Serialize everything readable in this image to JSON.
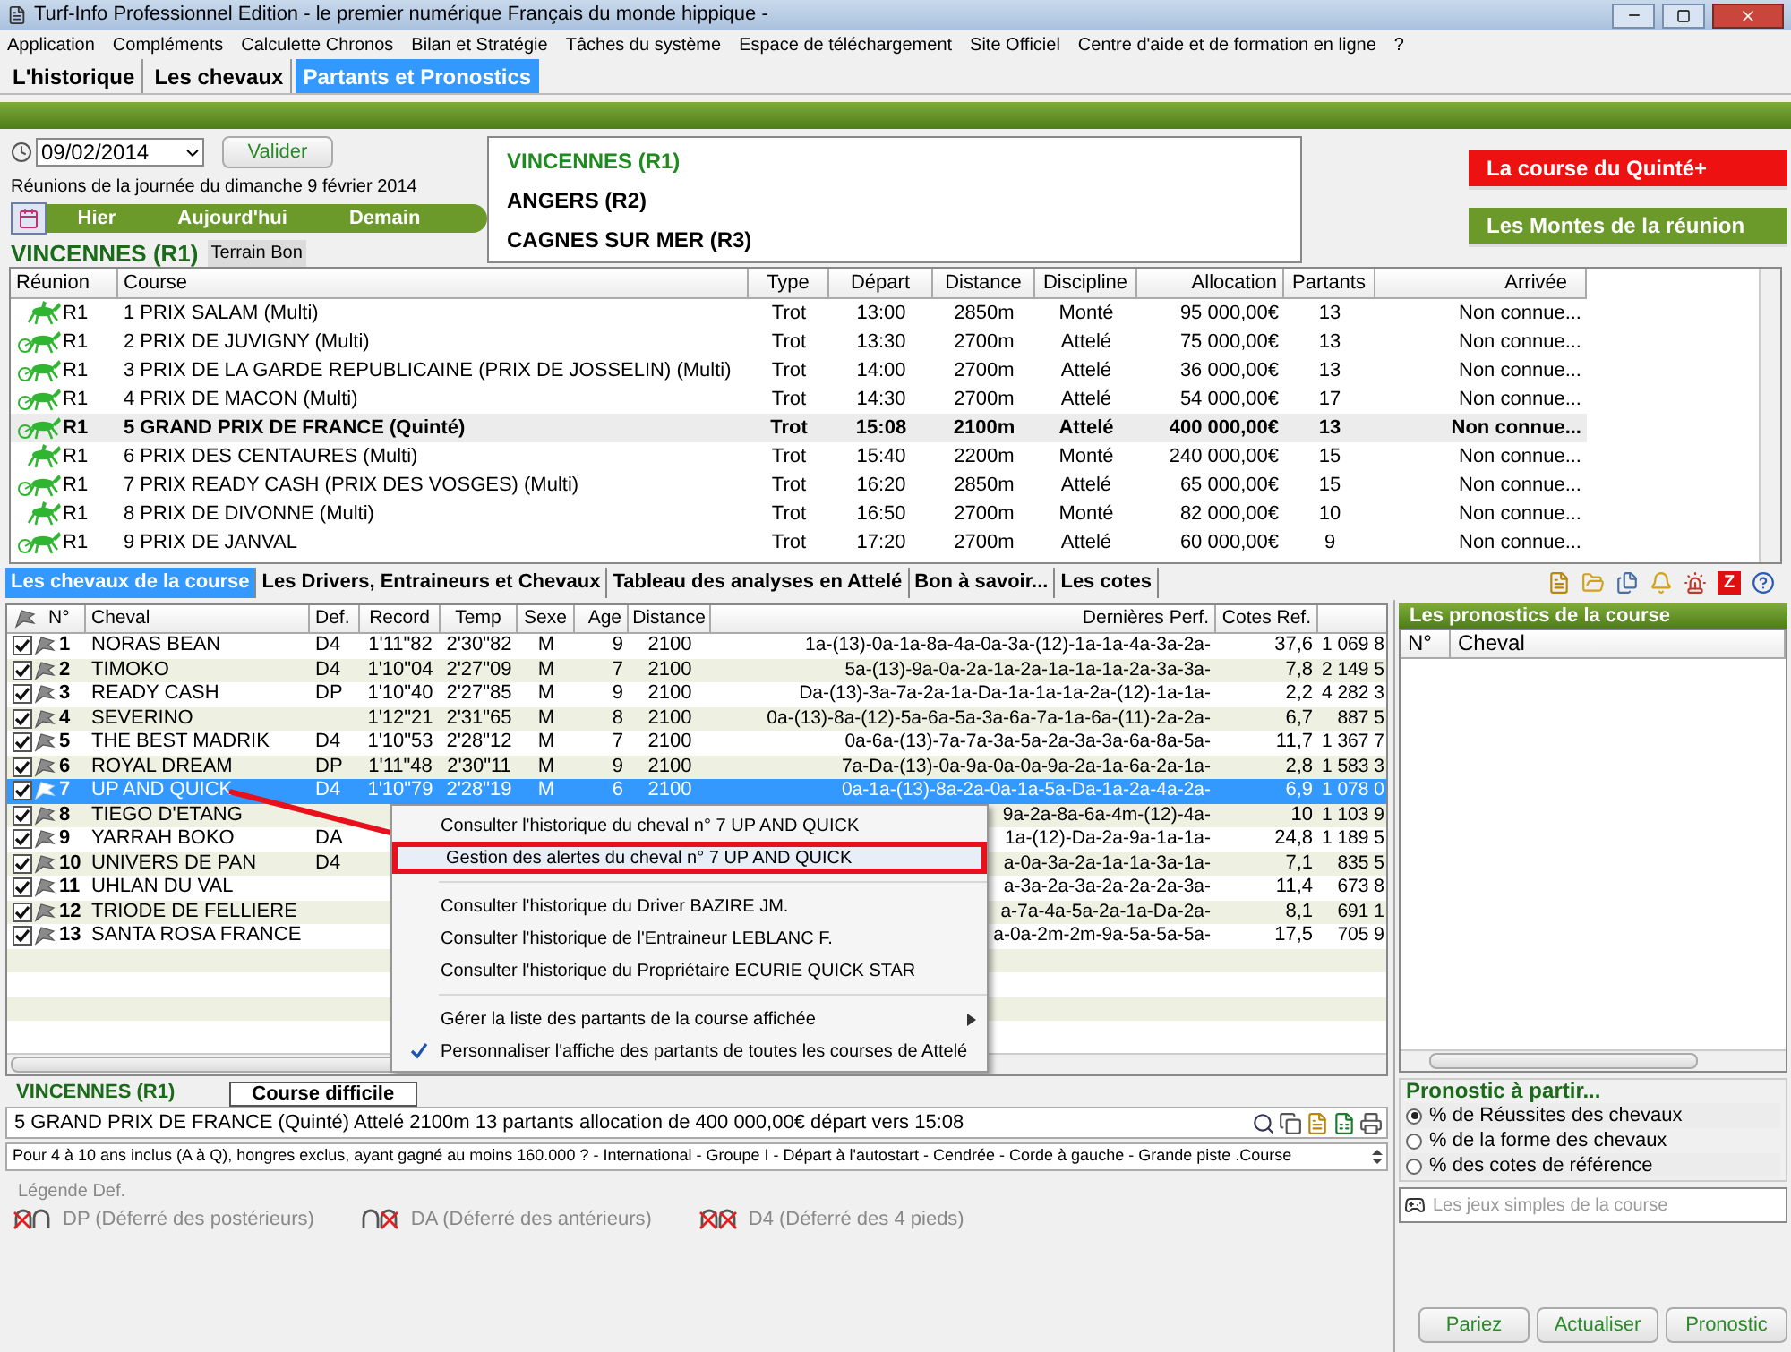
{
  "window": {
    "title": "Turf-Info Professionnel Edition - le premier numérique Français du monde hippique -"
  },
  "menu": [
    "Application",
    "Compléments",
    "Calculette Chronos",
    "Bilan et Stratégie",
    "Tâches du système",
    "Espace de téléchargement",
    "Site Officiel",
    "Centre d'aide et de formation en ligne",
    "?"
  ],
  "main_tabs": [
    {
      "label": "L'historique",
      "selected": false
    },
    {
      "label": "Les chevaux",
      "selected": false
    },
    {
      "label": "Partants et Pronostics",
      "selected": true
    }
  ],
  "date_field": {
    "value": "09/02/2014"
  },
  "validate_button": "Valider",
  "day_caption": "Réunions de la journée du dimanche 9 février 2014",
  "day_nav": [
    "Hier",
    "Aujourd'hui",
    "Demain"
  ],
  "current_meeting": {
    "name": "VINCENNES (R1)",
    "terrain": "Terrain Bon"
  },
  "meetings": [
    {
      "label": "VINCENNES (R1)",
      "selected": true
    },
    {
      "label": "ANGERS (R2)",
      "selected": false
    },
    {
      "label": "CAGNES SUR MER (R3)",
      "selected": false
    }
  ],
  "quick_buttons": [
    {
      "label": "La course du Quinté+",
      "color": "#ee1111"
    },
    {
      "label": "Les Montes de la réunion",
      "color": "#6b9a2b"
    }
  ],
  "races": {
    "columns": [
      "Réunion",
      "Course",
      "Type",
      "Départ",
      "Distance",
      "Discipline",
      "Allocation",
      "Partants",
      "Arrivée"
    ],
    "rows": [
      {
        "kind": "mounted",
        "reunion": "R1",
        "course": "1 PRIX SALAM (Multi)",
        "type": "Trot",
        "depart": "13:00",
        "distance": "2850m",
        "discipline": "Monté",
        "allocation": "95 000,00€",
        "partants": "13",
        "arrivee": "Non connue...",
        "selected": false
      },
      {
        "kind": "harness",
        "reunion": "R1",
        "course": "2 PRIX DE JUVIGNY (Multi)",
        "type": "Trot",
        "depart": "13:30",
        "distance": "2700m",
        "discipline": "Attelé",
        "allocation": "75 000,00€",
        "partants": "13",
        "arrivee": "Non connue...",
        "selected": false
      },
      {
        "kind": "harness",
        "reunion": "R1",
        "course": "3 PRIX DE LA GARDE REPUBLICAINE (PRIX DE JOSSELIN) (Multi)",
        "type": "Trot",
        "depart": "14:00",
        "distance": "2700m",
        "discipline": "Attelé",
        "allocation": "36 000,00€",
        "partants": "13",
        "arrivee": "Non connue...",
        "selected": false
      },
      {
        "kind": "harness",
        "reunion": "R1",
        "course": "4 PRIX DE MACON (Multi)",
        "type": "Trot",
        "depart": "14:30",
        "distance": "2700m",
        "discipline": "Attelé",
        "allocation": "54 000,00€",
        "partants": "17",
        "arrivee": "Non connue...",
        "selected": false
      },
      {
        "kind": "harness",
        "reunion": "R1",
        "course": "5 GRAND PRIX DE FRANCE (Quinté)",
        "type": "Trot",
        "depart": "15:08",
        "distance": "2100m",
        "discipline": "Attelé",
        "allocation": "400 000,00€",
        "partants": "13",
        "arrivee": "Non connue...",
        "selected": true
      },
      {
        "kind": "mounted",
        "reunion": "R1",
        "course": "6 PRIX DES CENTAURES (Multi)",
        "type": "Trot",
        "depart": "15:40",
        "distance": "2200m",
        "discipline": "Monté",
        "allocation": "240 000,00€",
        "partants": "15",
        "arrivee": "Non connue...",
        "selected": false
      },
      {
        "kind": "harness",
        "reunion": "R1",
        "course": "7 PRIX READY CASH (PRIX DES VOSGES) (Multi)",
        "type": "Trot",
        "depart": "16:20",
        "distance": "2850m",
        "discipline": "Attelé",
        "allocation": "65 000,00€",
        "partants": "15",
        "arrivee": "Non connue...",
        "selected": false
      },
      {
        "kind": "mounted",
        "reunion": "R1",
        "course": "8 PRIX DE DIVONNE (Multi)",
        "type": "Trot",
        "depart": "16:50",
        "distance": "2700m",
        "discipline": "Monté",
        "allocation": "82 000,00€",
        "partants": "10",
        "arrivee": "Non connue...",
        "selected": false
      },
      {
        "kind": "harness",
        "reunion": "R1",
        "course": "9 PRIX DE JANVAL",
        "type": "Trot",
        "depart": "17:20",
        "distance": "2700m",
        "discipline": "Attelé",
        "allocation": "60 000,00€",
        "partants": "9",
        "arrivee": "Non connue...",
        "selected": false
      }
    ]
  },
  "detail_tabs": [
    {
      "label": "Les chevaux de la course",
      "selected": true
    },
    {
      "label": "Les Drivers, Entraineurs et Chevaux",
      "selected": false
    },
    {
      "label": "Tableau des analyses en Attelé",
      "selected": false
    },
    {
      "label": "Bon à savoir...",
      "selected": false
    },
    {
      "label": "Les cotes",
      "selected": false
    }
  ],
  "toolbar_badge": "Z",
  "horses": {
    "columns": [
      "N°",
      "Cheval",
      "Def.",
      "Record",
      "Temp",
      "Sexe",
      "Age",
      "Distance",
      "Dernières Perf.",
      "Cotes Ref."
    ],
    "rows": [
      {
        "checked": true,
        "selected": false,
        "number": "1",
        "name": "NORAS BEAN",
        "def": "D4",
        "record": "1'11\"82",
        "temp": "2'30\"82",
        "sexe": "M",
        "age": "9",
        "distance": "2100",
        "perf": "1a-(13)-0a-1a-8a-4a-0a-3a-(12)-1a-1a-4a-3a-2a-",
        "cote": "37,6",
        "gains": "1 069 8"
      },
      {
        "checked": true,
        "selected": false,
        "number": "2",
        "name": "TIMOKO",
        "def": "D4",
        "record": "1'10\"04",
        "temp": "2'27\"09",
        "sexe": "M",
        "age": "7",
        "distance": "2100",
        "perf": "5a-(13)-9a-0a-2a-1a-2a-1a-1a-1a-2a-3a-3a-",
        "cote": "7,8",
        "gains": "2 149 5"
      },
      {
        "checked": true,
        "selected": false,
        "number": "3",
        "name": "READY CASH",
        "def": "DP",
        "record": "1'10\"40",
        "temp": "2'27\"85",
        "sexe": "M",
        "age": "9",
        "distance": "2100",
        "perf": "Da-(13)-3a-7a-2a-1a-Da-1a-1a-1a-2a-(12)-1a-1a-",
        "cote": "2,2",
        "gains": "4 282 3"
      },
      {
        "checked": true,
        "selected": false,
        "number": "4",
        "name": "SEVERINO",
        "record": "1'12\"21",
        "temp": "2'31\"65",
        "sexe": "M",
        "age": "8",
        "distance": "2100",
        "perf": "0a-(13)-8a-(12)-5a-6a-5a-3a-6a-7a-1a-6a-(11)-2a-2a-",
        "cote": "6,7",
        "gains": "887 5"
      },
      {
        "checked": true,
        "selected": false,
        "number": "5",
        "name": "THE BEST MADRIK",
        "def": "D4",
        "record": "1'10\"53",
        "temp": "2'28\"12",
        "sexe": "M",
        "age": "7",
        "distance": "2100",
        "perf": "0a-6a-(13)-7a-7a-3a-5a-2a-3a-3a-6a-8a-5a-",
        "cote": "11,7",
        "gains": "1 367 7"
      },
      {
        "checked": true,
        "selected": false,
        "number": "6",
        "name": "ROYAL DREAM",
        "def": "DP",
        "record": "1'11\"48",
        "temp": "2'30\"11",
        "sexe": "M",
        "age": "9",
        "distance": "2100",
        "perf": "7a-Da-(13)-0a-9a-0a-0a-9a-2a-1a-6a-2a-1a-",
        "cote": "2,8",
        "gains": "1 583 3"
      },
      {
        "checked": true,
        "selected": true,
        "number": "7",
        "name": "UP AND QUICK",
        "def": "D4",
        "record": "1'10\"79",
        "temp": "2'28\"19",
        "sexe": "M",
        "age": "6",
        "distance": "2100",
        "perf": "0a-1a-(13)-8a-2a-0a-1a-5a-Da-1a-2a-4a-2a-",
        "cote": "6,9",
        "gains": "1 078 0"
      },
      {
        "checked": true,
        "selected": false,
        "number": "8",
        "name": "TIEGO D'ETANG",
        "perf": "9a-2a-8a-6a-4m-(12)-4a-",
        "cote": "10",
        "gains": "1 103 9"
      },
      {
        "checked": true,
        "selected": false,
        "number": "9",
        "name": "YARRAH BOKO",
        "def": "DA",
        "perf": "1a-(12)-Da-2a-9a-1a-1a-",
        "cote": "24,8",
        "gains": "1 189 5"
      },
      {
        "checked": true,
        "selected": false,
        "number": "10",
        "name": "UNIVERS DE PAN",
        "def": "D4",
        "perf": "a-0a-3a-2a-1a-1a-3a-1a-",
        "cote": "7,1",
        "gains": "835 5"
      },
      {
        "checked": true,
        "selected": false,
        "number": "11",
        "name": "UHLAN DU VAL",
        "perf": "a-3a-2a-3a-2a-2a-2a-3a-",
        "cote": "11,4",
        "gains": "673 8"
      },
      {
        "checked": true,
        "selected": false,
        "number": "12",
        "name": "TRIODE DE FELLIERE",
        "perf": "a-7a-4a-5a-2a-1a-Da-2a-",
        "cote": "8,1",
        "gains": "691 1"
      },
      {
        "checked": true,
        "selected": false,
        "number": "13",
        "name": "SANTA ROSA FRANCE",
        "perf": "a-0a-2m-2m-9a-5a-5a-5a-",
        "cote": "17,5",
        "gains": "705 9"
      }
    ]
  },
  "context_menu": [
    {
      "kind": "item",
      "label": "Consulter l'historique du cheval n° 7 UP AND QUICK",
      "highlighted": false,
      "checked": false,
      "submenu": false
    },
    {
      "kind": "item",
      "label": "Gestion des alertes du cheval n° 7 UP AND QUICK",
      "highlighted": true,
      "checked": false,
      "submenu": false
    },
    {
      "kind": "separator"
    },
    {
      "kind": "item",
      "label": "Consulter l'historique du Driver BAZIRE JM.",
      "highlighted": false,
      "checked": false,
      "submenu": false
    },
    {
      "kind": "item",
      "label": "Consulter l'historique de l'Entraineur LEBLANC F.",
      "highlighted": false,
      "checked": false,
      "submenu": false
    },
    {
      "kind": "item",
      "label": "Consulter l'historique du Propriétaire ECURIE QUICK STAR",
      "highlighted": false,
      "checked": false,
      "submenu": false
    },
    {
      "kind": "separator"
    },
    {
      "kind": "item",
      "label": "Gérer la liste des partants de la course affichée",
      "highlighted": false,
      "checked": false,
      "submenu": true
    },
    {
      "kind": "item",
      "label": "Personnaliser l'affiche des partants de toutes les courses de Attelé",
      "highlighted": false,
      "checked": true,
      "submenu": false
    }
  ],
  "pronostics": {
    "title": "Les pronostics de la course",
    "columns": [
      "N°",
      "Cheval"
    ]
  },
  "pronostic_source": {
    "title": "Pronostic à partir...",
    "options": [
      {
        "label": "% de Réussites des chevaux",
        "selected": true
      },
      {
        "label": "% de la forme des chevaux",
        "selected": false
      },
      {
        "label": "% des cotes de référence",
        "selected": false
      }
    ]
  },
  "jeux_field": {
    "placeholder": "Les jeux simples de la course"
  },
  "action_buttons": [
    "Pariez",
    "Actualiser",
    "Pronostic"
  ],
  "race_summary": {
    "meeting": "VINCENNES (R1)",
    "difficulty": "Course difficile",
    "description": "5 GRAND PRIX DE FRANCE (Quinté) Attelé 2100m 13 partants allocation de 400 000,00€ départ vers 15:08",
    "conditions": "Pour 4 à 10 ans inclus (A à Q), hongres exclus, ayant gagné au moins 160.000 ? - International - Groupe I - Départ à l'autostart - Cendrée - Corde à gauche - Grande piste .Course"
  },
  "legend": {
    "title": "Légende Def.",
    "items": [
      {
        "kind": "hind",
        "label": "DP (Déferré des postérieurs)"
      },
      {
        "kind": "front",
        "label": "DA (Déferré des antérieurs)"
      },
      {
        "kind": "all",
        "label": "D4 (Déferré des 4 pieds)"
      }
    ]
  }
}
